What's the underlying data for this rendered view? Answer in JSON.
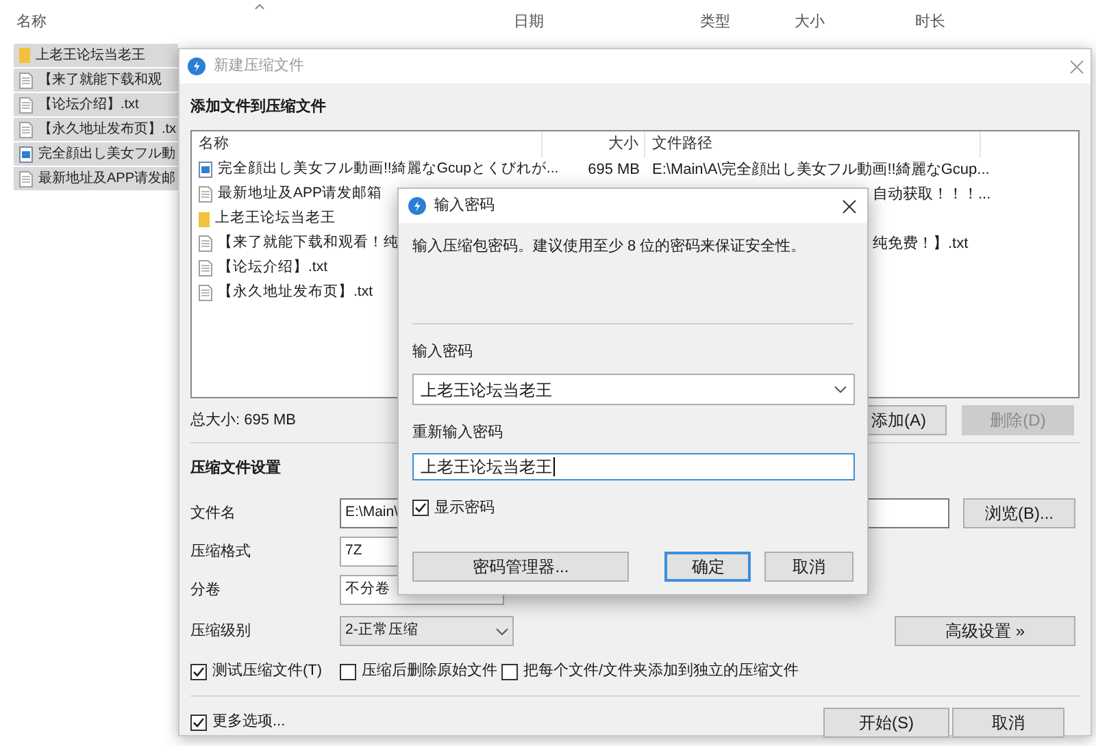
{
  "explorer": {
    "columns": [
      {
        "label": "名称"
      },
      {
        "label": "日期"
      },
      {
        "label": "类型"
      },
      {
        "label": "大小"
      },
      {
        "label": "时长"
      }
    ],
    "rows": [
      {
        "kind": "folder",
        "name": "上老王论坛当老王",
        "selected": true
      },
      {
        "kind": "text",
        "name": "【来了就能下载和观",
        "selected": true
      },
      {
        "kind": "text",
        "name": "【论坛介绍】.txt",
        "selected": true
      },
      {
        "kind": "text",
        "name": "【永久地址发布页】.tx",
        "selected": true
      },
      {
        "kind": "video",
        "name": "完全顔出し美女フル動",
        "selected": true
      },
      {
        "kind": "text",
        "name": "最新地址及APP请发邮",
        "selected": true
      }
    ]
  },
  "archive_dialog": {
    "title": "新建压缩文件",
    "heading": "添加文件到压缩文件",
    "file_list": {
      "columns": [
        "名称",
        "大小",
        "文件路径"
      ],
      "rows": [
        {
          "kind": "video",
          "name": "完全顔出し美女フル動画!!綺麗なGcupとくびれが...",
          "size": "695 MB",
          "path": "E:\\Main\\A\\完全顔出し美女フル動画!!綺麗なGcup...",
          "partial": false
        },
        {
          "kind": "text",
          "name": "最新地址及APP请发邮箱",
          "path": "自动获取！！！...",
          "partial": true
        },
        {
          "kind": "folder",
          "name": "上老王论坛当老王",
          "partial": false
        },
        {
          "kind": "text",
          "name": "【来了就能下载和观看！纯",
          "path": "纯免费！】.txt",
          "partial": true
        },
        {
          "kind": "text",
          "name": "【论坛介绍】.txt",
          "partial": false
        },
        {
          "kind": "text",
          "name": "【永久地址发布页】.txt",
          "partial": false
        }
      ]
    },
    "total_size": "总大小: 695 MB",
    "add_button": {
      "label": "添加(A)",
      "disabled": false
    },
    "delete_button": {
      "label": "删除(D)",
      "disabled": true
    },
    "settings_heading": "压缩文件设置",
    "file_name": {
      "label": "文件名",
      "value": "E:\\Main\\"
    },
    "browse_button": "浏览(B)...",
    "format": {
      "label": "压缩格式",
      "value": "7Z"
    },
    "split": {
      "label": "分卷",
      "value": "不分卷"
    },
    "level": {
      "label": "压缩级别",
      "value": "2-正常压缩"
    },
    "advanced_button": "高级设置 »",
    "options": [
      {
        "label": "测试压缩文件(T)",
        "checked": true
      },
      {
        "label": "压缩后删除原始文件",
        "checked": false
      },
      {
        "label": "把每个文件/文件夹添加到独立的压缩文件",
        "checked": false
      }
    ],
    "more_options": {
      "label": "更多选项...",
      "checked": true
    },
    "start_button": "开始(S)",
    "cancel_button": "取消"
  },
  "password_dialog": {
    "title": "输入密码",
    "hint": "输入压缩包密码。建议使用至少 8 位的密码来保证安全性。",
    "password": {
      "label": "输入密码",
      "value": "上老王论坛当老王"
    },
    "confirm": {
      "label": "重新输入密码",
      "value": "上老王论坛当老王"
    },
    "show_password": {
      "label": "显示密码",
      "checked": true
    },
    "manager_button": "密码管理器...",
    "ok_button": "确定",
    "cancel_button": "取消"
  }
}
